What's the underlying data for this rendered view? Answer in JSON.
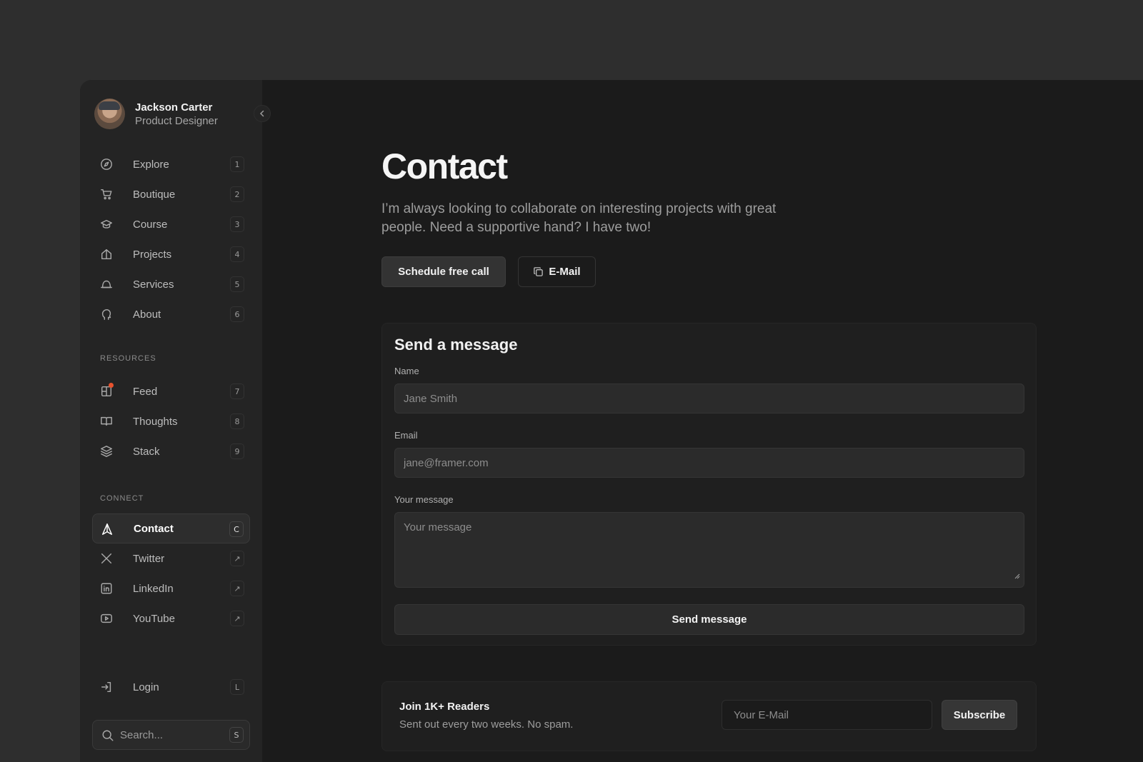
{
  "profile": {
    "name": "Jackson Carter",
    "role": "Product Designer"
  },
  "nav": {
    "main": [
      {
        "label": "Explore",
        "key": "1",
        "icon": "compass-icon"
      },
      {
        "label": "Boutique",
        "key": "2",
        "icon": "cart-icon"
      },
      {
        "label": "Course",
        "key": "3",
        "icon": "graduation-cap-icon"
      },
      {
        "label": "Projects",
        "key": "4",
        "icon": "house-icon"
      },
      {
        "label": "Services",
        "key": "5",
        "icon": "bell-icon"
      },
      {
        "label": "About",
        "key": "6",
        "icon": "head-icon"
      }
    ],
    "resources_title": "RESOURCES",
    "resources": [
      {
        "label": "Feed",
        "key": "7",
        "icon": "feed-icon"
      },
      {
        "label": "Thoughts",
        "key": "8",
        "icon": "book-icon"
      },
      {
        "label": "Stack",
        "key": "9",
        "icon": "layers-icon"
      }
    ],
    "connect_title": "CONNECT",
    "connect": [
      {
        "label": "Contact",
        "key": "C",
        "icon": "send-icon",
        "active": true
      },
      {
        "label": "Twitter",
        "key": "↗",
        "icon": "x-logo-icon"
      },
      {
        "label": "LinkedIn",
        "key": "↗",
        "icon": "linkedin-icon"
      },
      {
        "label": "YouTube",
        "key": "↗",
        "icon": "youtube-icon"
      }
    ],
    "login": {
      "label": "Login",
      "key": "L"
    },
    "search": {
      "placeholder": "Search...",
      "key": "S"
    }
  },
  "page": {
    "title": "Contact",
    "subtitle": "I’m always looking to collaborate on interesting projects with great people. Need a supportive hand? I have two!",
    "primary_button": "Schedule free call",
    "email_button": "E-Mail"
  },
  "form": {
    "title": "Send a message",
    "name_label": "Name",
    "name_placeholder": "Jane Smith",
    "email_label": "Email",
    "email_placeholder": "jane@framer.com",
    "message_label": "Your message",
    "message_placeholder": "Your message",
    "submit": "Send message"
  },
  "newsletter": {
    "title": "Join 1K+ Readers",
    "subtitle": "Sent out every two weeks. No spam.",
    "input_placeholder": "Your E-Mail",
    "button": "Subscribe"
  },
  "colors": {
    "background": "#2e2e2e",
    "panel": "#1b1b1b",
    "sidebar": "#242424",
    "notification": "#e8522e"
  }
}
